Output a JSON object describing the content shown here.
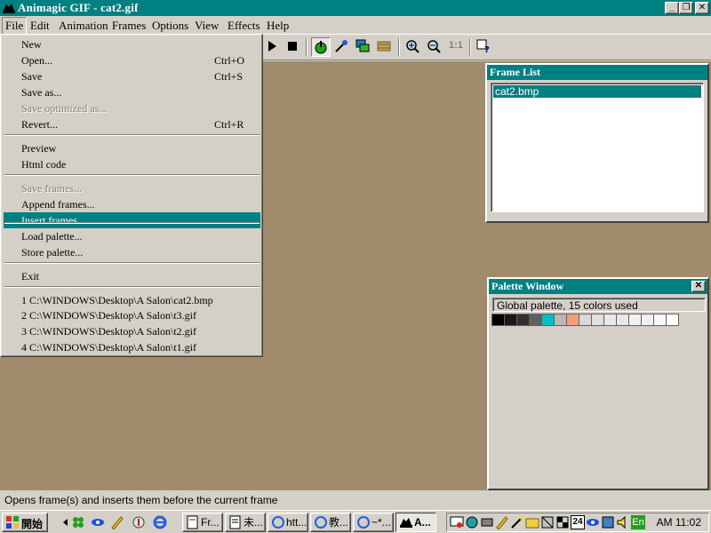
{
  "window": {
    "title": "Animagic GIF - cat2.gif"
  },
  "menubar": {
    "items": [
      "File",
      "Edit",
      "Animation",
      "Frames",
      "Options",
      "View",
      "Effects",
      "Help"
    ]
  },
  "file_menu": {
    "items": [
      {
        "label": "New",
        "shortcut": "",
        "disabled": false
      },
      {
        "label": "Open...",
        "shortcut": "Ctrl+O",
        "disabled": false
      },
      {
        "label": "Save",
        "shortcut": "Ctrl+S",
        "disabled": false
      },
      {
        "label": "Save as...",
        "shortcut": "",
        "disabled": false
      },
      {
        "label": "Save optimized as...",
        "shortcut": "",
        "disabled": true
      },
      {
        "label": "Revert...",
        "shortcut": "Ctrl+R",
        "disabled": false
      },
      {
        "label": "Preview",
        "shortcut": "",
        "disabled": false
      },
      {
        "label": "Html code",
        "shortcut": "",
        "disabled": false
      },
      {
        "label": "Save frames...",
        "shortcut": "",
        "disabled": true
      },
      {
        "label": "Append frames...",
        "shortcut": "",
        "disabled": false
      },
      {
        "label": "Insert frames...",
        "shortcut": "",
        "disabled": false,
        "highlighted": true
      },
      {
        "label": "Load palette...",
        "shortcut": "",
        "disabled": false
      },
      {
        "label": "Store palette...",
        "shortcut": "",
        "disabled": false
      },
      {
        "label": "Exit",
        "shortcut": "",
        "disabled": false
      },
      {
        "label": "1 C:\\WINDOWS\\Desktop\\A  Salon\\cat2.bmp",
        "shortcut": "",
        "disabled": false
      },
      {
        "label": "2 C:\\WINDOWS\\Desktop\\A  Salon\\t3.gif",
        "shortcut": "",
        "disabled": false
      },
      {
        "label": "3 C:\\WINDOWS\\Desktop\\A  Salon\\t2.gif",
        "shortcut": "",
        "disabled": false
      },
      {
        "label": "4 C:\\WINDOWS\\Desktop\\A  Salon\\t1.gif",
        "shortcut": "",
        "disabled": false
      }
    ]
  },
  "frame_list": {
    "title": "Frame List",
    "items": [
      "cat2.bmp"
    ]
  },
  "palette_window": {
    "title": "Palette Window",
    "info": "Global palette, 15 colors used",
    "colors": [
      "#000000",
      "#181818",
      "#303030",
      "#606060",
      "#00c0c0",
      "#b8b8b8",
      "#f0a080",
      "#d8d8d8",
      "#e0e0e0",
      "#e8e8e8",
      "#e8e8e8",
      "#f0f0f0",
      "#f0f0f0",
      "#f8f8f8",
      "#ffffff"
    ]
  },
  "toolbar": {
    "icons": [
      "play-icon",
      "stop-icon",
      "hand-icon",
      "eyedropper-icon",
      "frames-icon",
      "strip-icon",
      "zoom-in-icon",
      "zoom-out-icon",
      "actual-size-icon",
      "help-icon"
    ],
    "actual_size_label": "1:1"
  },
  "status": {
    "text": "Opens frame(s) and inserts them before the current frame"
  },
  "taskbar": {
    "start_label": "開始",
    "tasks": [
      "Fr...",
      "未...",
      "htt...",
      "教...",
      "~*...",
      "A..."
    ],
    "clock": "AM 11:02",
    "lang": "En",
    "calendar_day": "24"
  }
}
